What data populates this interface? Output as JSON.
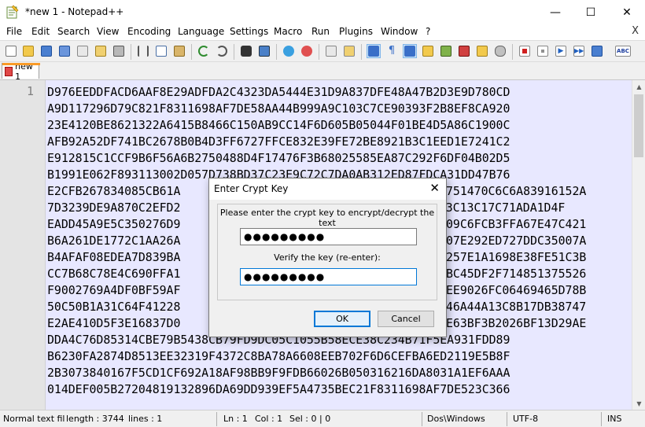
{
  "window": {
    "title": "*new 1 - Notepad++",
    "minimize": "—",
    "maximize": "☐",
    "close": "✕"
  },
  "menu": {
    "items": [
      "File",
      "Edit",
      "Search",
      "View",
      "Encoding",
      "Language",
      "Settings",
      "Macro",
      "Run",
      "Plugins",
      "Window",
      "?"
    ],
    "close": "X"
  },
  "tabs": [
    {
      "label": "new 1",
      "close": "✕",
      "modified": true
    }
  ],
  "editor": {
    "line_number": "1",
    "lines": [
      "D976EEDDFACD6AAF8E29ADFDA2C4323DA5444E31D9A837DFE48A47B2D3E9D780CD",
      "A9D117296D79C821F8311698AF7DE58AA44B999A9C103C7CE90393F2B8EF8CA920",
      "23E4120BE8621322A6415B8466C150AB9CC14F6D605B05044F01BE4D5A86C1900C",
      "AFB92A52DF741BC2678B0B4D3FF6727FFCE832E39FE72BE8921B3C1EED1E7241C2",
      "E912815C1CCF9B6F56A6B2750488D4F17476F3B68025585EA87C292F6DF04B02D5",
      "B1991E062F893113002D057D738BD37C23E9C72C7DA0AB312ED87FDCA31DD47B76",
      "E2CFB267834085CB61A",
      "7D3239DE9A870C2EFD2",
      "EADD45A9E5C350276D9",
      "B6A261DE1772C1AA26A",
      "B4AFAF08EDEA7D839BA",
      "CC7B68C78E4C690FFA1",
      "F9002769A4DF0BF59AF",
      "50C50B1A31C64F41228",
      "E2AE410D5F3E16837D0",
      "DDA4C76D85314CBE79B5438CB79FD9DC05C1055B58ECE38C234B71F5EA931FDD89",
      "B6230FA2874D8513EE32319F4372C8BA78A6608EEB702F6D6CEFBA6ED2119E5B8F",
      "2B3073840167F5CD1CF692A18AF98BB9F9FDB66026B050316216DA8031A1EF6AAA",
      "014DEF005B27204819132896DA69DD939EF5A4735BEC21F8311698AF7DE523C366"
    ],
    "right_fragments": [
      "751470C6C6A83916152A",
      "A7F3C13C17C71ADA1D4F",
      "09C6FCB3FFA67E47C421",
      "07E292ED727DDC35007A",
      "257E1A1698E38FE51C3B",
      "BC45DF2F714851375526",
      "EE9026FC06469465D78B",
      "E46A44A13C8B17DB38747",
      "E63BF3B2026BF13D29AE"
    ]
  },
  "status": {
    "type": "Normal text fil",
    "length": "length : 3744",
    "lines": "lines : 1",
    "ln": "Ln : 1",
    "col": "Col : 1",
    "sel": "Sel : 0 | 0",
    "eol": "Dos\\Windows",
    "encoding": "UTF-8",
    "ins": "INS"
  },
  "dialog": {
    "title": "Enter Crypt Key",
    "close": "✕",
    "prompt": "Please enter the crypt key to encrypt/decrypt the text",
    "key_value": "●●●●●●●●●",
    "verify_label": "Verify the key (re-enter):",
    "verify_value": "●●●●●●●●●",
    "ok": "OK",
    "cancel": "Cancel"
  },
  "toolbar_icons": [
    "new-file-icon",
    "open-file-icon",
    "save-icon",
    "save-all-icon",
    "close-icon",
    "close-all-icon",
    "print-icon",
    "cut-icon",
    "copy-icon",
    "paste-icon",
    "undo-icon",
    "redo-icon",
    "find-icon",
    "replace-icon",
    "zoom-in-icon",
    "zoom-out-icon",
    "sync-v-icon",
    "sync-h-icon",
    "word-wrap-icon",
    "all-chars-icon",
    "indent-guide-icon",
    "udl-icon",
    "doc-map-icon",
    "function-list-icon",
    "folder-workspace-icon",
    "monitor-icon",
    "record-macro-icon",
    "stop-record-icon",
    "play-macro-icon",
    "play-multi-icon",
    "save-macro-icon",
    "spell-check-icon"
  ],
  "colors": {
    "editor_bg": "#e8e8ff",
    "gutter_bg": "#e4e4e4",
    "tab_accent": "#fa9b28",
    "dialog_focus": "#0078d7"
  }
}
